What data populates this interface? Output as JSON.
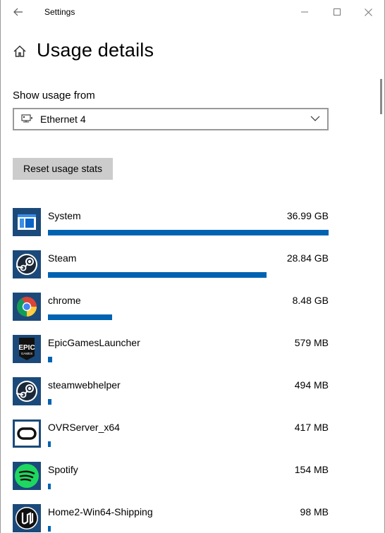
{
  "window": {
    "title": "Settings"
  },
  "page": {
    "title": "Usage details"
  },
  "filter": {
    "label": "Show usage from",
    "selected": "Ethernet 4"
  },
  "actions": {
    "reset_label": "Reset usage stats"
  },
  "colors": {
    "accent": "#0063b1",
    "button_bg": "#cccccc"
  },
  "apps": [
    {
      "name": "System",
      "usage": "36.99 GB",
      "fraction": 1.0,
      "icon": "system-icon"
    },
    {
      "name": "Steam",
      "usage": "28.84 GB",
      "fraction": 0.78,
      "icon": "steam-icon"
    },
    {
      "name": "chrome",
      "usage": "8.48 GB",
      "fraction": 0.229,
      "icon": "chrome-icon"
    },
    {
      "name": "EpicGamesLauncher",
      "usage": "579 MB",
      "fraction": 0.0153,
      "icon": "epic-games-icon"
    },
    {
      "name": "steamwebhelper",
      "usage": "494 MB",
      "fraction": 0.013,
      "icon": "steam-icon"
    },
    {
      "name": "OVRServer_x64",
      "usage": "417 MB",
      "fraction": 0.011,
      "icon": "oculus-icon"
    },
    {
      "name": "Spotify",
      "usage": "154 MB",
      "fraction": 0.004,
      "icon": "spotify-icon"
    },
    {
      "name": "Home2-Win64-Shipping",
      "usage": "98 MB",
      "fraction": 0.0026,
      "icon": "unreal-icon"
    }
  ]
}
